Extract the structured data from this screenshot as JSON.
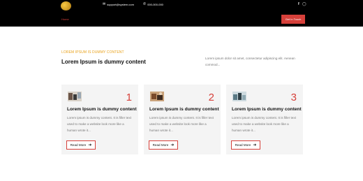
{
  "topbar": {
    "email": "support@system.com",
    "phone": "000-000-000",
    "email_icon": "mail-icon",
    "phone_icon": "phone-icon",
    "social_icons": [
      "facebook-icon",
      "instagram-icon"
    ]
  },
  "nav": {
    "home_label": "Home",
    "cta_label": "Get In Touch"
  },
  "intro": {
    "eyebrow": "LOREM IPSUM IS DUMMY CONTENT",
    "headline": "Lorem Ipsum is dummy content",
    "paragraph": "Lorem ipsum dolor sit amet, consectetur adipiscing elit. Aenean commod..."
  },
  "cards": [
    {
      "number": "1",
      "title": "Lorem Ipsum is dummy content",
      "text": "Lorem ipsum is dummy content. It is filler text used to make a website look more like a human wrote it...",
      "button": "Read More"
    },
    {
      "number": "2",
      "title": "Lorem Ipsum is dummy content",
      "text": "Lorem ipsum is dummy content. It is filler text used to make a website look more like a human wrote it...",
      "button": "Read More"
    },
    {
      "number": "3",
      "title": "Lorem Ipsum is dummy content",
      "text": "Lorem ipsum is dummy content. It is filler text used to make a website look more like a human wrote it...",
      "button": "Read More"
    }
  ],
  "colors": {
    "accent": "#d6403a",
    "eyebrow": "#e9a21b",
    "topbar": "#000000",
    "card_bg": "#f4f4f4"
  }
}
